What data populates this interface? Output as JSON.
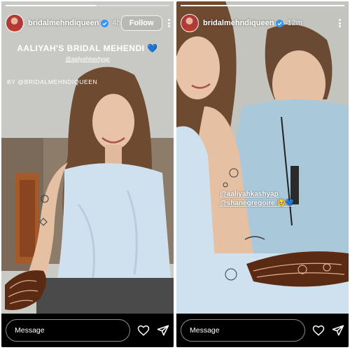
{
  "stories": [
    {
      "progress": 0.55,
      "username": "bridalmehndiqueen",
      "time": "4h",
      "follow_label": "Follow",
      "title": "AALIYAH'S BRIDAL MEHENDI",
      "title_emoji": "💙",
      "mention": "@aaliyahkashyap",
      "credit": "BY @BRIDALMEHNDIQUEEN",
      "message_placeholder": "Message",
      "icons": [
        "verified-icon",
        "more-icon",
        "heart-icon",
        "send-icon"
      ]
    },
    {
      "progress": 1.0,
      "username": "bridalmehndiqueen",
      "time": "12m",
      "tag_1": "@aaliyahkashyap",
      "tag_2": "@shanegregoire 🥹💙",
      "message_placeholder": "Message",
      "icons": [
        "verified-icon",
        "more-icon",
        "heart-icon",
        "send-icon"
      ]
    }
  ],
  "colors": {
    "verified": "#3897f0",
    "dress": "#cfe0ee",
    "shirt": "#a9c9da",
    "henna": "#5a2a12",
    "wall": "#c9cac5"
  }
}
